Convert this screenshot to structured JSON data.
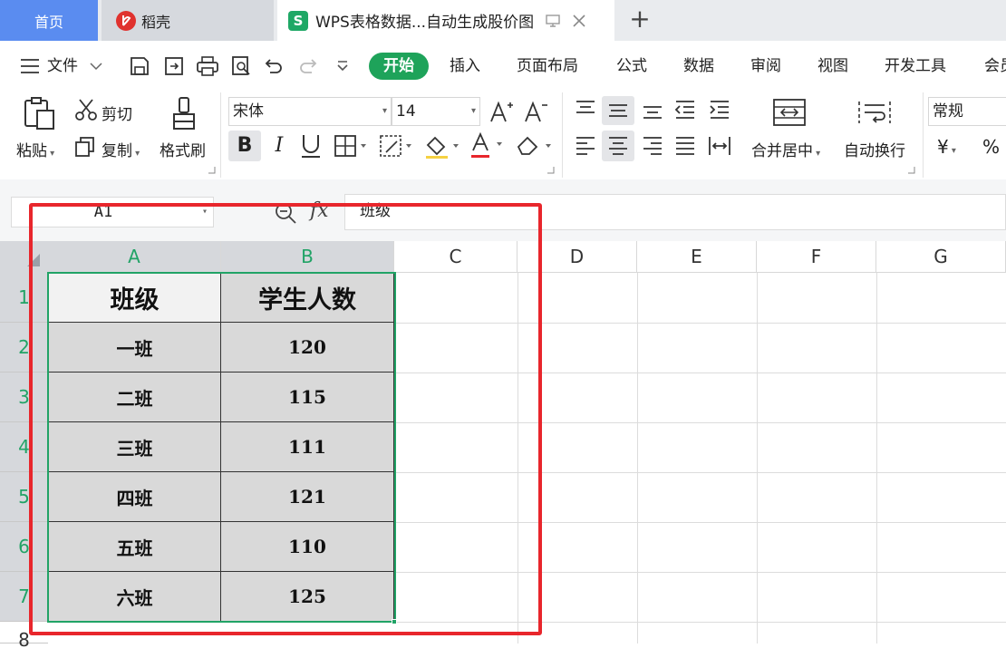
{
  "tabs": {
    "home": "首页",
    "daoke": "稻壳",
    "doc": "WPS表格数据...自动生成股价图",
    "add": "+"
  },
  "menu": {
    "file": "文件",
    "items": [
      "开始",
      "插入",
      "页面布局",
      "公式",
      "数据",
      "审阅",
      "视图",
      "开发工具",
      "会员"
    ]
  },
  "ribbon": {
    "paste": "粘贴",
    "cut": "剪切",
    "copy": "复制",
    "format_painter": "格式刷",
    "font_name": "宋体",
    "font_size": "14",
    "merge_center": "合并居中",
    "wrap_text": "自动换行",
    "number_format": "常规",
    "currency": "¥",
    "percent": "%"
  },
  "formula_bar": {
    "cell_ref": "A1",
    "fx": "fx",
    "content": "班级"
  },
  "grid": {
    "columns": [
      "A",
      "B",
      "C",
      "D",
      "E",
      "F",
      "G"
    ],
    "rows": [
      "1",
      "2",
      "3",
      "4",
      "5",
      "6",
      "7",
      "8"
    ],
    "header": [
      "班级",
      "学生人数"
    ],
    "data": [
      [
        "一班",
        "120"
      ],
      [
        "二班",
        "115"
      ],
      [
        "三班",
        "111"
      ],
      [
        "四班",
        "121"
      ],
      [
        "五班",
        "110"
      ],
      [
        "六班",
        "125"
      ]
    ]
  },
  "colors": {
    "accent_green": "#21a366",
    "highlight_red": "#e8262c",
    "home_tab": "#5a8cf0",
    "start_button": "#1ea35a"
  }
}
